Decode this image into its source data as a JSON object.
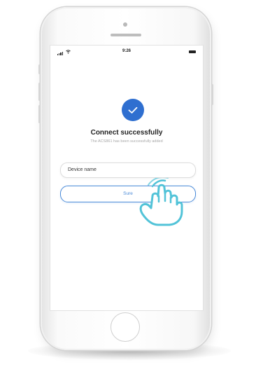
{
  "status_bar": {
    "time": "9:26"
  },
  "success": {
    "icon": "check-icon",
    "title": "Connect successfully",
    "message": "The ACS861 has been successfully added"
  },
  "form": {
    "device_name_placeholder": "Device name",
    "sure_label": "Sure"
  },
  "colors": {
    "accent": "#2f6fd0",
    "button_border": "#4a8ad8",
    "hand_outline": "#52c3d8"
  },
  "icons": {
    "signal": "cellular-signal-icon",
    "wifi": "wifi-icon",
    "battery": "battery-icon",
    "hand": "tap-hand-icon"
  }
}
